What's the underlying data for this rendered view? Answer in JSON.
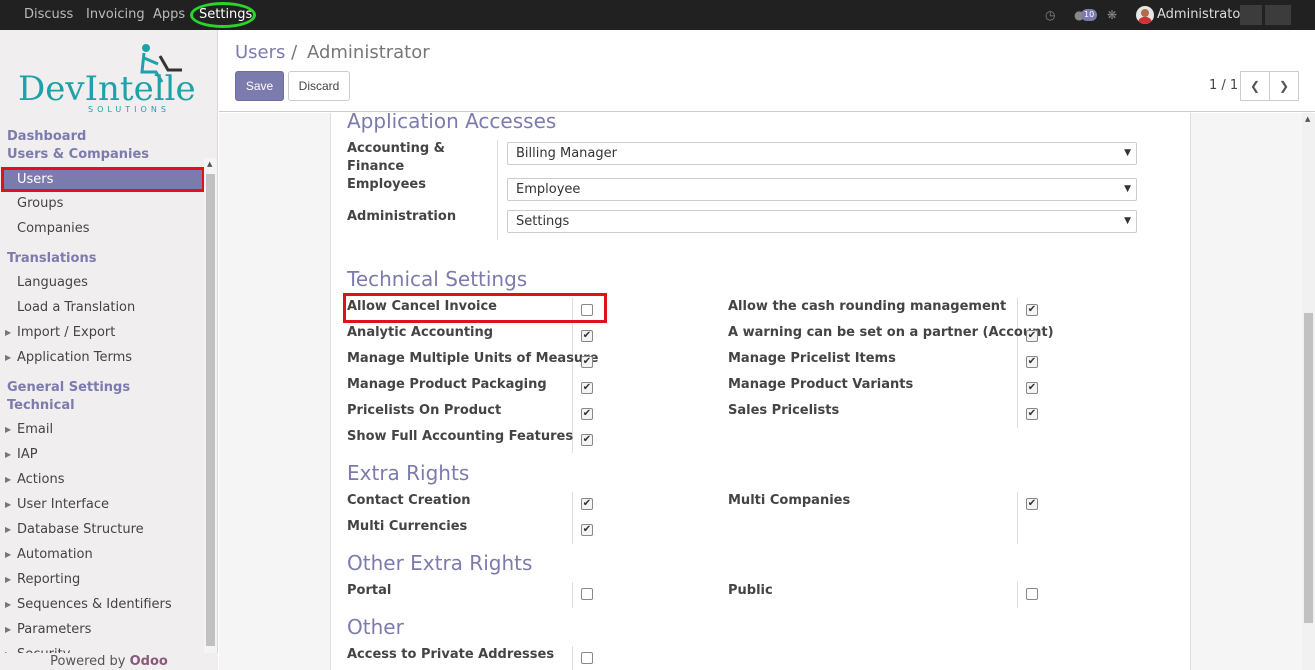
{
  "topbar": {
    "menus": [
      "Discuss",
      "Invoicing",
      "Apps",
      "Settings"
    ],
    "activity_icon": "clock-icon",
    "chat_icon": "chat-bubble-icon",
    "chat_count": "10",
    "debug_icon": "bug-icon",
    "user_name": "Administrator"
  },
  "sidebar": {
    "logo_main": "DevIntelle",
    "logo_sub": "SOLUTIONS",
    "dashboard": "Dashboard",
    "users_companies": "Users & Companies",
    "users": "Users",
    "groups": "Groups",
    "companies": "Companies",
    "translations": "Translations",
    "languages": "Languages",
    "load_translation": "Load a Translation",
    "import_export": "Import / Export",
    "application_terms": "Application Terms",
    "general_settings": "General Settings",
    "technical": "Technical",
    "technical_items": [
      "Email",
      "IAP",
      "Actions",
      "User Interface",
      "Database Structure",
      "Automation",
      "Reporting",
      "Sequences & Identifiers",
      "Parameters",
      "Security"
    ],
    "powered_by": "Powered by",
    "powered_brand": "Odoo"
  },
  "control": {
    "breadcrumb_parent": "Users",
    "breadcrumb_sep": "/",
    "breadcrumb_current": "Administrator",
    "save": "Save",
    "discard": "Discard",
    "pager": "1 / 1"
  },
  "form": {
    "app_access_title": "Application Accesses",
    "accounting_label_1": "Accounting &",
    "accounting_label_2": "Finance",
    "employees_label": "Employees",
    "administration_label": "Administration",
    "accounting_value": "Billing Manager",
    "employees_value": "Employee",
    "administration_value": "Settings",
    "technical_title": "Technical Settings",
    "technical_left": [
      {
        "label": "Allow Cancel Invoice",
        "checked": false
      },
      {
        "label": "Analytic Accounting",
        "checked": true
      },
      {
        "label": "Manage Multiple Units of Measure",
        "checked": true
      },
      {
        "label": "Manage Product Packaging",
        "checked": true
      },
      {
        "label": "Pricelists On Product",
        "checked": true
      },
      {
        "label": "Show Full Accounting Features",
        "checked": true
      }
    ],
    "technical_right": [
      {
        "label": "Allow the cash rounding management",
        "checked": true
      },
      {
        "label": "A warning can be set on a partner (Account)",
        "checked": true
      },
      {
        "label": "Manage Pricelist Items",
        "checked": true
      },
      {
        "label": "Manage Product Variants",
        "checked": true
      },
      {
        "label": "Sales Pricelists",
        "checked": true
      }
    ],
    "extra_title": "Extra Rights",
    "extra_left": [
      {
        "label": "Contact Creation",
        "checked": true
      },
      {
        "label": "Multi Currencies",
        "checked": true
      }
    ],
    "extra_right": [
      {
        "label": "Multi Companies",
        "checked": true
      }
    ],
    "other_extra_title": "Other Extra Rights",
    "other_extra_left": [
      {
        "label": "Portal",
        "checked": false
      }
    ],
    "other_extra_right": [
      {
        "label": "Public",
        "checked": false
      }
    ],
    "other_title": "Other",
    "other_left": [
      {
        "label": "Access to Private Addresses",
        "checked": false
      }
    ]
  },
  "colors": {
    "accent": "#7c7bad",
    "highlight_red": "#e1111b",
    "highlight_green": "#27d627",
    "logo": "#1ea1a8"
  }
}
